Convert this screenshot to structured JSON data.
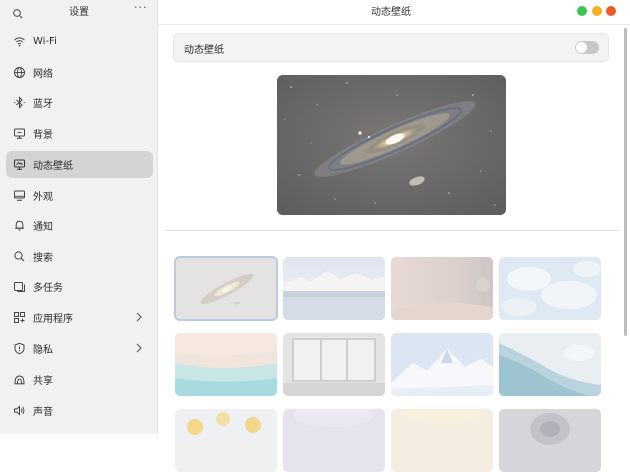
{
  "sidebar": {
    "title": "设置",
    "more": "···",
    "items": [
      {
        "label": "Wi-Fi",
        "icon": "wifi-icon"
      },
      {
        "label": "网络",
        "icon": "globe-icon"
      },
      {
        "label": "蓝牙",
        "icon": "bluetooth-icon"
      },
      {
        "label": "背景",
        "icon": "monitor-icon"
      },
      {
        "label": "动态壁纸",
        "icon": "monitor-icon",
        "active": true
      },
      {
        "label": "外观",
        "icon": "display-icon"
      },
      {
        "label": "通知",
        "icon": "bell-icon"
      },
      {
        "label": "搜索",
        "icon": "search-icon"
      },
      {
        "label": "多任务",
        "icon": "multitask-icon"
      },
      {
        "label": "应用程序",
        "icon": "apps-icon",
        "chevron": true
      },
      {
        "label": "隐私",
        "icon": "shield-icon",
        "chevron": true
      },
      {
        "label": "共享",
        "icon": "share-icon"
      },
      {
        "label": "声音",
        "icon": "speaker-icon"
      }
    ]
  },
  "main": {
    "title": "动态壁纸",
    "toggle": {
      "label": "动态壁纸",
      "enabled": false
    }
  },
  "window_controls": {
    "colors": {
      "green": "#3cc453",
      "yellow": "#f5b022",
      "red": "#f05a28"
    }
  },
  "wallpapers": [
    {
      "name": "galaxy",
      "selected": true
    },
    {
      "name": "snowy-peaks-clouds"
    },
    {
      "name": "planet-horizon"
    },
    {
      "name": "cloud-sea"
    },
    {
      "name": "beach-shore"
    },
    {
      "name": "window-view"
    },
    {
      "name": "snow-mountain"
    },
    {
      "name": "aerial-coast"
    },
    {
      "name": "yellow-flowers"
    },
    {
      "name": "purple-gradient"
    },
    {
      "name": "sunlight-glow"
    },
    {
      "name": "dark-portal"
    }
  ]
}
